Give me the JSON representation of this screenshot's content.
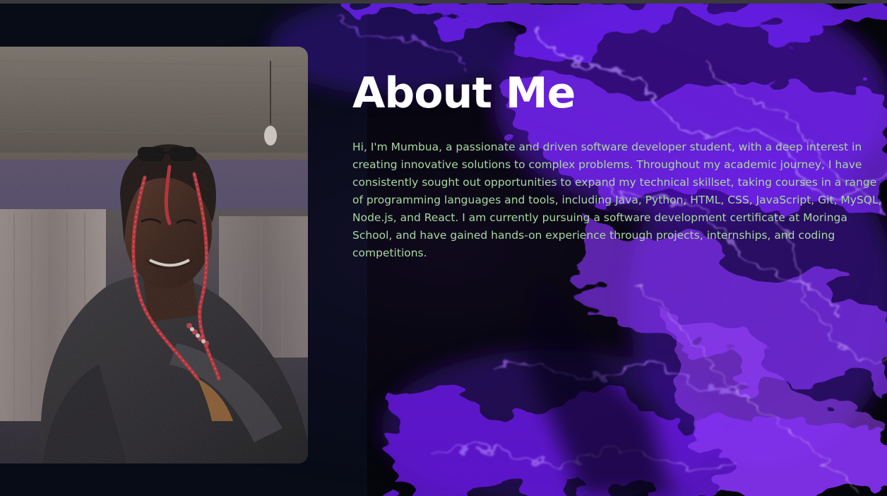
{
  "about": {
    "title": "About Me",
    "bio": "Hi, I'm Mumbua, a passionate and driven software developer student, with a deep interest in creating innovative solutions to complex problems. Throughout my academic journey, I have consistently sought out opportunities to expand my technical skillset, taking courses in a range of programming languages and tools, including Java, Python, HTML, CSS, JavaScript, Git, MySQL, Node.js, and React. I am currently pursuing a software development certificate at Moringa School, and have gained hands-on experience through projects, internships, and coding competitions."
  },
  "colors": {
    "background": "#05060a",
    "accent_purple": "#7b22ff",
    "title": "#ffffff",
    "body_text": "#a7d8a0"
  }
}
